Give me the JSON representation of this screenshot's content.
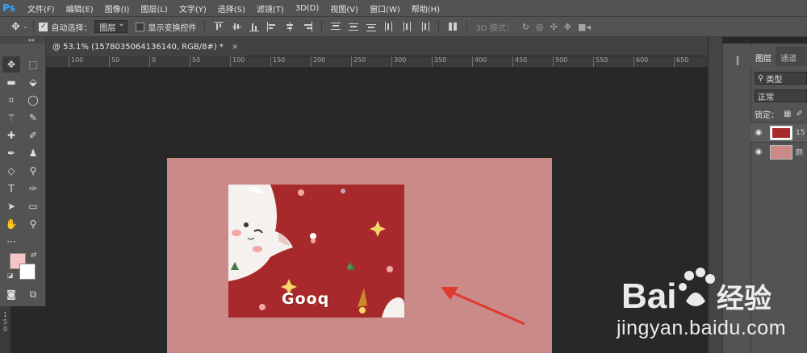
{
  "app": {
    "logo": "Ps"
  },
  "menu": [
    "文件(F)",
    "编辑(E)",
    "图像(I)",
    "图层(L)",
    "文字(Y)",
    "选择(S)",
    "滤镜(T)",
    "3D(D)",
    "视图(V)",
    "窗口(W)",
    "帮助(H)"
  ],
  "options": {
    "auto_select_label": "自动选择：",
    "auto_select_checked": true,
    "auto_select_value": "图层",
    "show_transform_label": "显示变换控件",
    "show_transform_checked": false,
    "mode_3d_label": "3D 模式："
  },
  "document": {
    "tab_title": "@ 53.1% (1578035064136140, RGB/8#) *",
    "close_glyph": "×",
    "ruler_marks": [
      "100",
      "50",
      "0",
      "50",
      "100",
      "150",
      "200",
      "250",
      "300",
      "350",
      "400",
      "450",
      "500",
      "550",
      "600",
      "650"
    ],
    "ruler_left_marks": [
      "1",
      "5",
      "0"
    ],
    "canvas_color": "#c98a88",
    "art_text": "Gooq"
  },
  "layers_panel": {
    "tabs": [
      "图层",
      "通道"
    ],
    "filter_value": "类型",
    "blend_mode": "正常",
    "lock_label": "锁定：",
    "layers": [
      {
        "name": "15",
        "thumb_color": "#a8292b"
      },
      {
        "name": "颜",
        "thumb_color": "#c98a88"
      }
    ]
  },
  "watermark": {
    "logo_text": "Bai 经验",
    "url": "jingyan.baidu.com"
  },
  "colors": {
    "foreground": "#f6c6c6",
    "background": "#ffffff",
    "arrow": "#e03a2f"
  }
}
